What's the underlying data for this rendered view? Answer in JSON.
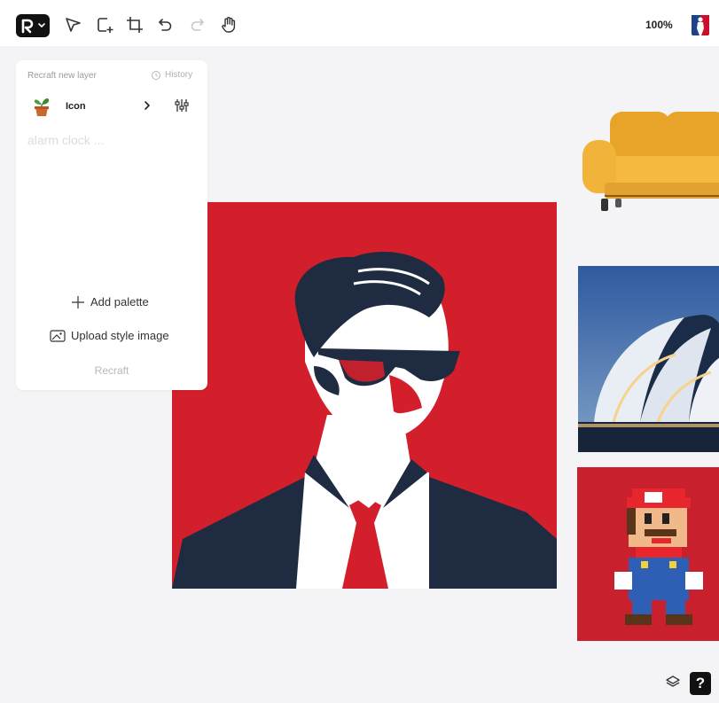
{
  "toolbar": {
    "zoom": "100%",
    "tools": [
      "logo-icon",
      "pointer-icon",
      "add-frame-icon",
      "crop-icon",
      "undo-icon",
      "redo-icon",
      "hand-icon"
    ]
  },
  "panel": {
    "title": "Recraft new layer",
    "history_label": "History",
    "style_label": "Icon",
    "prompt_placeholder": "alarm clock ...",
    "add_palette_label": "Add palette",
    "upload_style_label": "Upload style image",
    "recraft_label": "Recraft"
  },
  "canvas": {
    "images": [
      "portrait-man-sunglasses",
      "yellow-sofa",
      "futuristic-building",
      "pixel-mario"
    ]
  },
  "footer": {
    "help_label": "?"
  },
  "colors": {
    "accent_red": "#d31f2b",
    "navy": "#1e2b40",
    "sofa_yellow": "#f2b33a"
  }
}
